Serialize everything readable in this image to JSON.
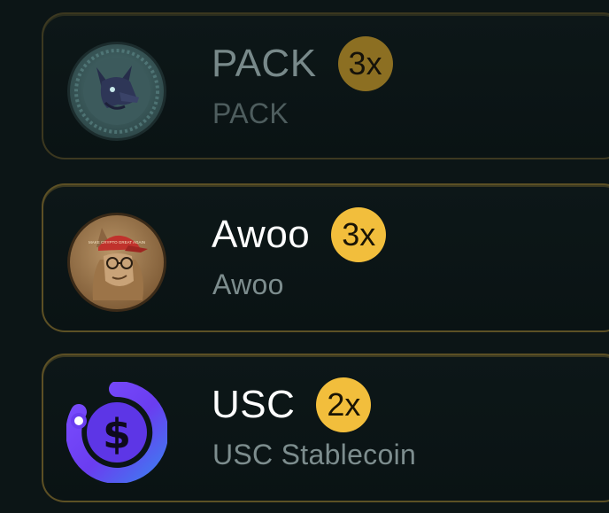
{
  "tokens": [
    {
      "name": "PACK",
      "multiplier": "3x",
      "subtitle": "PACK",
      "icon": "wolf-coin-icon",
      "state": "dimmed"
    },
    {
      "name": "Awoo",
      "multiplier": "3x",
      "subtitle": "Awoo",
      "icon": "awoo-coin-icon",
      "icon_text": "MAKE CRYPTO GREAT AGAIN",
      "state": "normal"
    },
    {
      "name": "USC",
      "multiplier": "2x",
      "subtitle": "USC Stablecoin",
      "icon": "usc-dollar-icon",
      "state": "normal"
    }
  ],
  "colors": {
    "background": "#0c1516",
    "badge": "#f2be3c",
    "badge_dim": "#8c6f22",
    "border_gold": "#a08232",
    "usc_purple": "#6a3df0"
  }
}
